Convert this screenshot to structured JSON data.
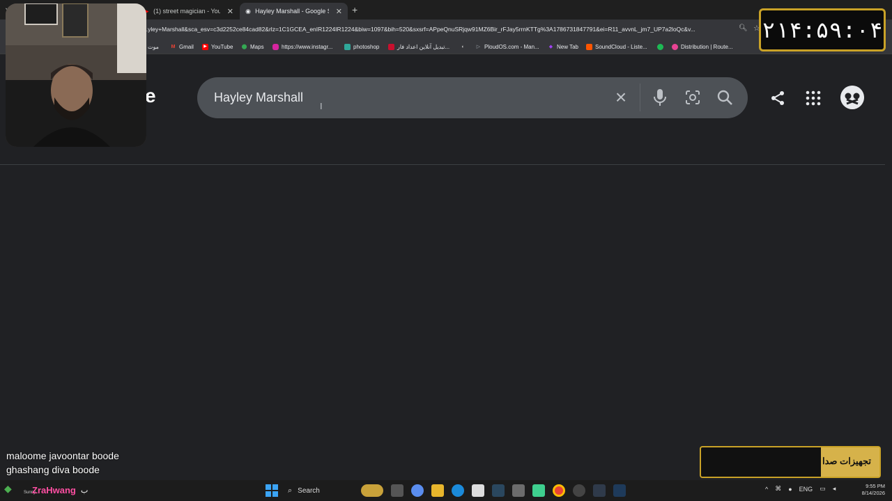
{
  "browser": {
    "tabs": [
      {
        "title": "(1) street magician - YouTube",
        "active": false
      },
      {
        "title": "Hayley Marshall - Google Sear...",
        "active": true
      }
    ],
    "address_url": "...yley+Marshall&sca_esv=c3d2252ce84cad82&rlz=1C1GCEA_enIR1224IR1224&biw=1097&bih=520&sxsrf=APpeQnuSRjqw91MZ6Bir_rFJay5rrnKTTg%3A1786731847791&ei=R11_avvnL_jm7_UP7a2loQc&v...",
    "bookmarks": [
      {
        "label": "موت",
        "icon": "folder-icon"
      },
      {
        "label": "Gmail",
        "icon": "gmail-icon"
      },
      {
        "label": "YouTube",
        "icon": "youtube-icon"
      },
      {
        "label": "Maps",
        "icon": "maps-icon"
      },
      {
        "label": "https://www.instagr...",
        "icon": "instagram-icon"
      },
      {
        "label": "photoshop",
        "icon": "photoshop-icon"
      },
      {
        "label": "تبدیل آنلاین اعداد فار...",
        "icon": "flag-icon"
      },
      {
        "label": "",
        "icon": "globe-icon"
      },
      {
        "label": "PloudOS.com - Man...",
        "icon": "ploudos-icon"
      },
      {
        "label": "New Tab",
        "icon": "newtab-icon"
      },
      {
        "label": "SoundCloud - Liste...",
        "icon": "soundcloud-icon"
      },
      {
        "label": "",
        "icon": "spotify-icon"
      },
      {
        "label": "Distribution | Route...",
        "icon": "distribution-icon"
      }
    ]
  },
  "google": {
    "logo_fragment": "e",
    "search_value": "Hayley Marshall"
  },
  "overlays": {
    "timer": "۲۱۴:۵۹:۰۴",
    "chat": [
      "maloome javoontar boode",
      "ghashang diva boode"
    ],
    "username": "ZraHwang",
    "username_suffix": "ب",
    "sound_banner": "تجهیزات صدا"
  },
  "taskbar": {
    "weather": "Sunny",
    "search_label": "Search",
    "lang": "ENG",
    "time": "9:55 PM",
    "date": "8/14/2026"
  },
  "colors": {
    "page_bg": "#202124",
    "searchbox_bg": "#4d5156",
    "accent_gold": "#c9a227",
    "username_pink": "#ff4fa3"
  }
}
